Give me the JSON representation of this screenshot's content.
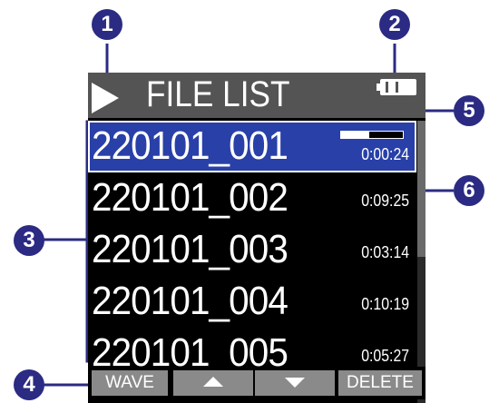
{
  "screen": {
    "title": "FILE LIST",
    "files": [
      {
        "name": "220101_001",
        "duration": "0:00:24",
        "selected": true,
        "progress": 0.45
      },
      {
        "name": "220101_002",
        "duration": "0:09:25"
      },
      {
        "name": "220101_003",
        "duration": "0:03:14"
      },
      {
        "name": "220101_004",
        "duration": "0:10:19"
      },
      {
        "name": "220101_005",
        "duration": "0:05:27"
      }
    ]
  },
  "softkeys": {
    "left": "WAVE",
    "up_icon": "up-triangle-icon",
    "down_icon": "down-triangle-icon",
    "right": "DELETE"
  },
  "callouts": [
    "1",
    "2",
    "3",
    "4",
    "5",
    "6"
  ],
  "colors": {
    "callout_bg": "#2b2b83",
    "selected_row": "#2840a8",
    "titlebar": "#545454",
    "softkey": "#8a8a8a"
  }
}
